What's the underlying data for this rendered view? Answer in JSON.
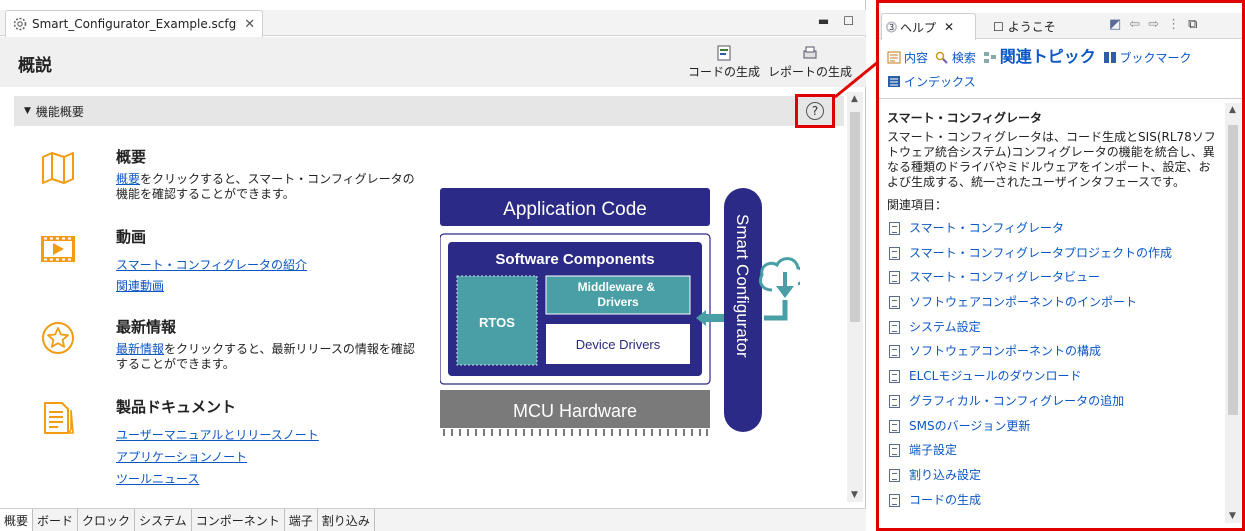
{
  "editor": {
    "tab_label": "Smart_Configurator_Example.scfg",
    "page_title": "概説",
    "generate_code_label": "コードの生成",
    "generate_report_label": "レポートの生成",
    "section_title": "機能概要",
    "features": [
      {
        "title": "概要",
        "desc_link": "概要",
        "desc_rest": "をクリックすると、スマート・コンフィグレータの機能を確認することができます。",
        "icon": "map-icon"
      },
      {
        "title": "動画",
        "links": [
          "スマート・コンフィグレータの紹介",
          "関連動画"
        ],
        "icon": "video-icon"
      },
      {
        "title": "最新情報",
        "desc_link": "最新情報",
        "desc_rest": "をクリックすると、最新リリースの情報を確認することができます。",
        "icon": "star-badge-icon"
      },
      {
        "title": "製品ドキュメント",
        "links": [
          "ユーザーマニュアルとリリースノート",
          "アプリケーションノート",
          "ツールニュース"
        ],
        "icon": "document-icon"
      }
    ],
    "diagram": {
      "application": "Application Code",
      "software": "Software Components",
      "middleware": "Middleware & Drivers",
      "rtos": "RTOS",
      "device_drivers": "Device Drivers",
      "mcu": "MCU Hardware",
      "smart_config": "Smart Configurator"
    },
    "bottom_tabs": [
      "概要",
      "ボード",
      "クロック",
      "システム",
      "コンポーネント",
      "端子",
      "割り込み"
    ]
  },
  "help": {
    "tab_help": "ヘルプ",
    "tab_welcome": "ようこそ",
    "nav": {
      "contents": "内容",
      "search": "検索",
      "related": "関連トピック",
      "bookmarks": "ブックマーク",
      "index": "インデックス"
    },
    "heading": "スマート・コンフィグレータ",
    "body": "スマート・コンフィグレータは、コード生成とSIS(RL78ソフトウェア統合システム)コンフィグレータの機能を統合し、異なる種類のドライバやミドルウェアをインポート、設定、および生成する、統一されたユーザインタフェースです。",
    "related_label": "関連項目：",
    "related_items": [
      "スマート・コンフィグレータ",
      "スマート・コンフィグレータプロジェクトの作成",
      "スマート・コンフィグレータビュー",
      "ソフトウェアコンポーネントのインポート",
      "システム設定",
      "ソフトウェアコンポーネントの構成",
      "ELCLモジュールのダウンロード",
      "グラフィカル・コンフィグレータの追加",
      "SMSのバージョン更新",
      "端子設定",
      "割り込み設定",
      "コードの生成"
    ]
  },
  "colors": {
    "accent_red": "#e00000",
    "diagram_navy": "#2b2a86",
    "diagram_teal": "#4a9fa6",
    "diagram_gray": "#7a7a7a",
    "link_blue": "#0b57c4",
    "icon_orange": "#f39c12"
  }
}
